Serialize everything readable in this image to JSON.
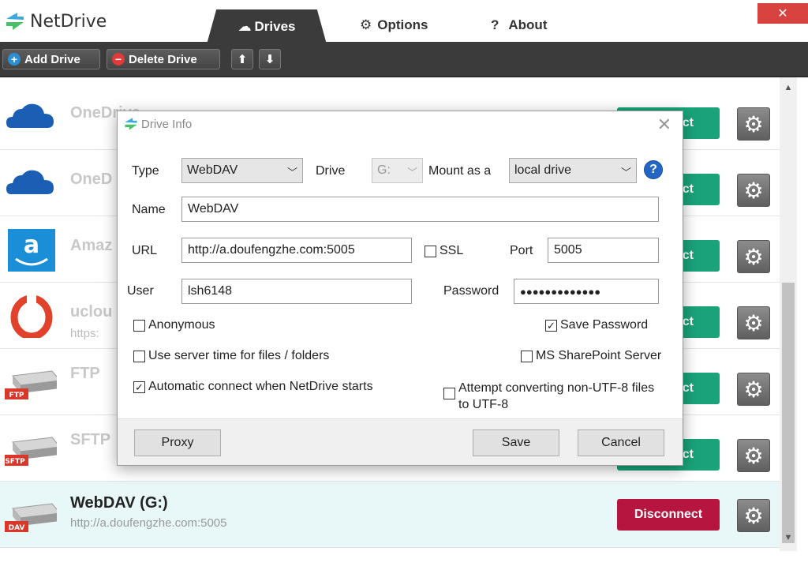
{
  "app": {
    "title": "NetDrive",
    "close_glyph": "✕"
  },
  "tabs": [
    {
      "label": "Drives",
      "icon": "cloud-icon",
      "active": true
    },
    {
      "label": "Options",
      "icon": "gear-icon"
    },
    {
      "label": "About",
      "icon": "question-icon",
      "icon_glyph": "?"
    }
  ],
  "toolbar": {
    "add_label": "Add Drive",
    "delete_label": "Delete Drive",
    "up_glyph": "⬆",
    "down_glyph": "⬇"
  },
  "drives": [
    {
      "name": "OneDrive",
      "url": "",
      "icon": "onedrive-icon",
      "action": "Connect"
    },
    {
      "name": "OneD",
      "url": "",
      "icon": "onedrive-icon",
      "action": "Connect"
    },
    {
      "name": "Amaz",
      "url": "",
      "icon": "amazon-icon",
      "action": "Connect"
    },
    {
      "name": "uclou",
      "url": "https:",
      "icon": "ucloud-icon",
      "action": "Connect"
    },
    {
      "name": "FTP",
      "url": "",
      "icon": "ftp-drive-icon",
      "badge": "FTP",
      "action": "Connect"
    },
    {
      "name": "SFTP",
      "url": "",
      "icon": "sftp-drive-icon",
      "badge": "SFTP",
      "action": "Connect"
    },
    {
      "name": "WebDAV (G:)",
      "url": "http://a.doufengzhe.com:5005",
      "icon": "dav-drive-icon",
      "badge": "DAV",
      "action": "Disconnect",
      "active": true
    }
  ],
  "dialog": {
    "title": "Drive Info",
    "type_label": "Type",
    "type_value": "WebDAV",
    "drive_label": "Drive",
    "drive_value": "G:",
    "mount_label": "Mount as a",
    "mount_value": "local drive",
    "help_glyph": "?",
    "name_label": "Name",
    "name_value": "WebDAV",
    "url_label": "URL",
    "url_value": "http://a.doufengzhe.com:5005",
    "ssl_label": "SSL",
    "port_label": "Port",
    "port_value": "5005",
    "user_label": "User",
    "user_value": "lsh6148",
    "password_label": "Password",
    "password_value": "●●●●●●●●●●●●●",
    "anonymous_label": "Anonymous",
    "save_password_label": "Save Password",
    "server_time_label": "Use server time for files / folders",
    "sharepoint_label": "MS SharePoint Server",
    "auto_connect_label": "Automatic connect when NetDrive starts",
    "utf8_label_1": "Attempt converting non-UTF-8 files",
    "utf8_label_2": "to UTF-8",
    "proxy_label": "Proxy",
    "save_label": "Save",
    "cancel_label": "Cancel",
    "checked_glyph": "✓",
    "checks": {
      "anonymous": false,
      "save_password": true,
      "server_time": false,
      "sharepoint": false,
      "auto_connect": true,
      "utf8": false,
      "ssl": false
    }
  },
  "colors": {
    "connect": "#1aa37a",
    "disconnect": "#b5153e",
    "close": "#d9433f",
    "toolbar": "#3b3b3b"
  }
}
